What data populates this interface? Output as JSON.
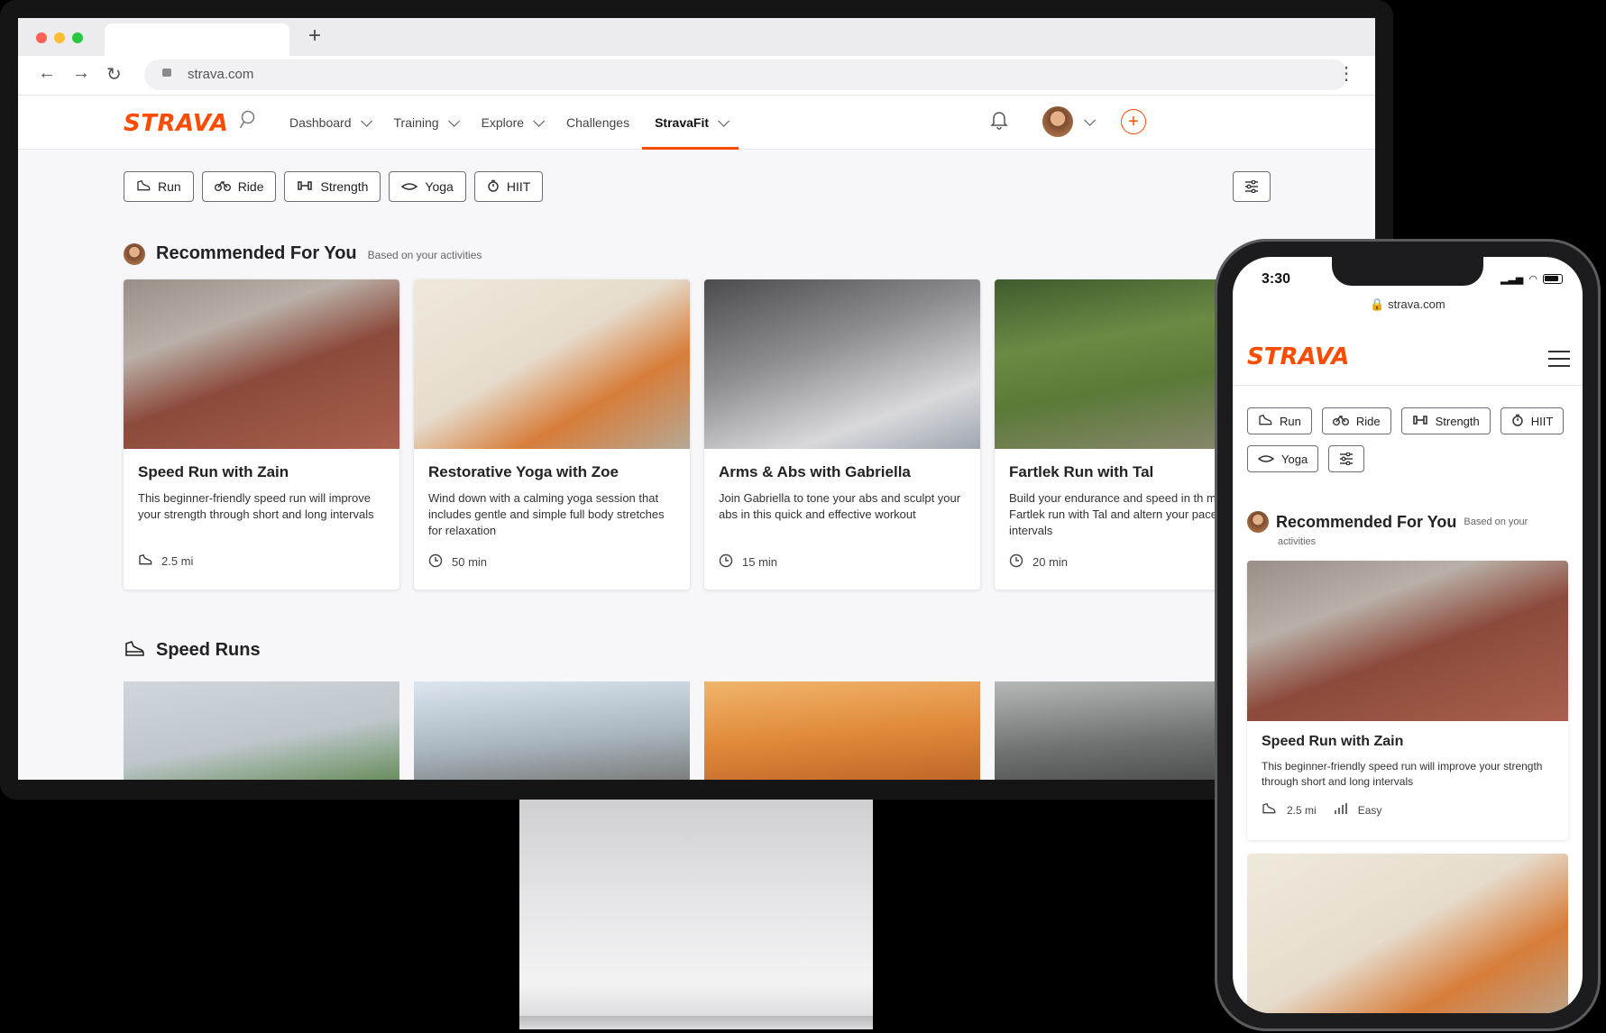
{
  "browser": {
    "url": "strava.com",
    "new_tab": "+"
  },
  "nav": {
    "logo": "STRAVA",
    "items": [
      {
        "label": "Dashboard",
        "dropdown": true,
        "active": false
      },
      {
        "label": "Training",
        "dropdown": true,
        "active": false
      },
      {
        "label": "Explore",
        "dropdown": true,
        "active": false
      },
      {
        "label": "Challenges",
        "dropdown": false,
        "active": false
      },
      {
        "label": "StravaFit",
        "dropdown": true,
        "active": true
      }
    ],
    "add_icon": "+"
  },
  "filters": [
    {
      "label": "Run",
      "icon": "shoe-icon"
    },
    {
      "label": "Ride",
      "icon": "bike-icon"
    },
    {
      "label": "Strength",
      "icon": "dumbbell-icon"
    },
    {
      "label": "Yoga",
      "icon": "yoga-icon"
    },
    {
      "label": "HIIT",
      "icon": "stopwatch-icon"
    }
  ],
  "recommended": {
    "title": "Recommended For You",
    "subtitle": "Based on your activities",
    "cards": [
      {
        "title": "Speed Run with Zain",
        "desc": "This beginner-friendly speed run will improve your strength through short and long intervals",
        "meta": "2.5 mi",
        "meta_icon": "shoe-icon"
      },
      {
        "title": "Restorative Yoga with Zoe",
        "desc": "Wind down with a calming yoga session that includes gentle and simple full body stretches for relaxation",
        "meta": "50 min",
        "meta_icon": "clock-icon"
      },
      {
        "title": "Arms & Abs with Gabriella",
        "desc": "Join Gabriella to tone your abs and sculpt your abs in this quick and effective workout",
        "meta": "15 min",
        "meta_icon": "clock-icon"
      },
      {
        "title": "Fartlek Run with Tal",
        "desc": "Build your endurance and speed in th minute Fartlek run with Tal and altern your pace across intervals",
        "meta": "20 min",
        "meta_icon": "clock-icon"
      }
    ]
  },
  "speed_runs": {
    "title": "Speed Runs"
  },
  "phone": {
    "time": "3:30",
    "url": "strava.com",
    "logo": "STRAVA",
    "filters": [
      "Run",
      "Ride",
      "Strength",
      "HIIT",
      "Yoga"
    ],
    "rec_title": "Recommended For You",
    "rec_sub_line1": "Based on your",
    "rec_sub_line2": "activities",
    "card": {
      "title": "Speed Run with Zain",
      "desc": "This beginner-friendly speed run will improve your strength through short and long intervals",
      "distance": "2.5 mi",
      "level": "Easy"
    }
  },
  "colors": {
    "brand": "#fc4c02"
  }
}
